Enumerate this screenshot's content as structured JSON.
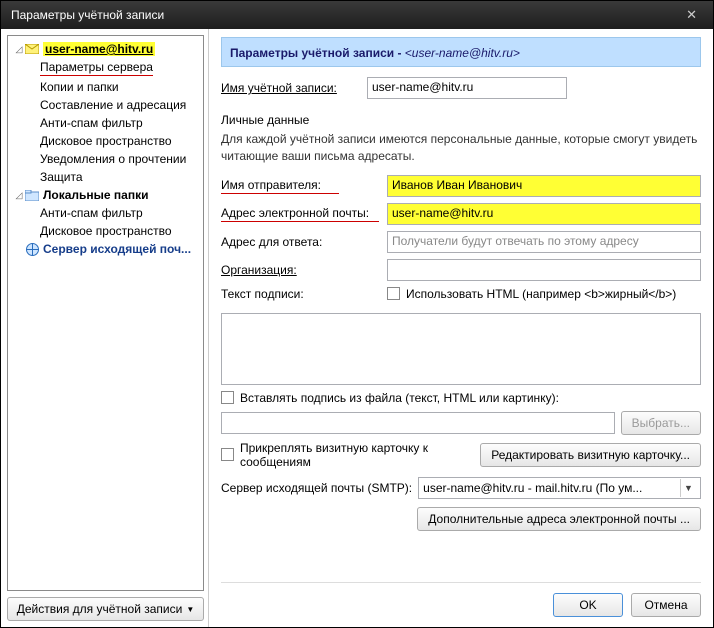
{
  "window": {
    "title": "Параметры учётной записи"
  },
  "tree": {
    "account": "user-name@hitv.ru",
    "items": [
      "Параметры сервера",
      "Копии и папки",
      "Составление и адресация",
      "Анти-спам фильтр",
      "Дисковое пространство",
      "Уведомления о прочтении",
      "Защита"
    ],
    "local": "Локальные папки",
    "local_items": [
      "Анти-спам фильтр",
      "Дисковое пространство"
    ],
    "smtp": "Сервер исходящей поч..."
  },
  "actions_btn": "Действия для учётной записи",
  "header": {
    "prefix": "Параметры учётной записи - ",
    "email": "<user-name@hitv.ru>"
  },
  "form": {
    "acct_name_label": "Имя учётной записи:",
    "acct_name_value": "user-name@hitv.ru",
    "personal_section": "Личные данные",
    "personal_desc": "Для каждой учётной записи имеются персональные данные, которые смогут увидеть читающие ваши письма адресаты.",
    "sender_label": "Имя отправителя:",
    "sender_value": "Иванов Иван Иванович",
    "email_label": "Адрес электронной почты:",
    "email_value": "user-name@hitv.ru",
    "reply_label": "Адрес для ответа:",
    "reply_placeholder": "Получатели будут отвечать по этому адресу",
    "org_label": "Организация:",
    "sig_label": "Текст подписи:",
    "sig_html_chk": "Использовать HTML (например <b>жирный</b>)",
    "sig_file_chk": "Вставлять подпись из файла (текст, HTML или картинку):",
    "browse_btn": "Выбрать...",
    "vcard_chk": "Прикреплять визитную карточку к сообщениям",
    "vcard_btn": "Редактировать визитную карточку...",
    "smtp_label": "Сервер исходящей почты (SMTP):",
    "smtp_value": "user-name@hitv.ru - mail.hitv.ru      (По ум...",
    "more_addr_btn": "Дополнительные адреса электронной почты ..."
  },
  "footer": {
    "ok": "OK",
    "cancel": "Отмена"
  }
}
